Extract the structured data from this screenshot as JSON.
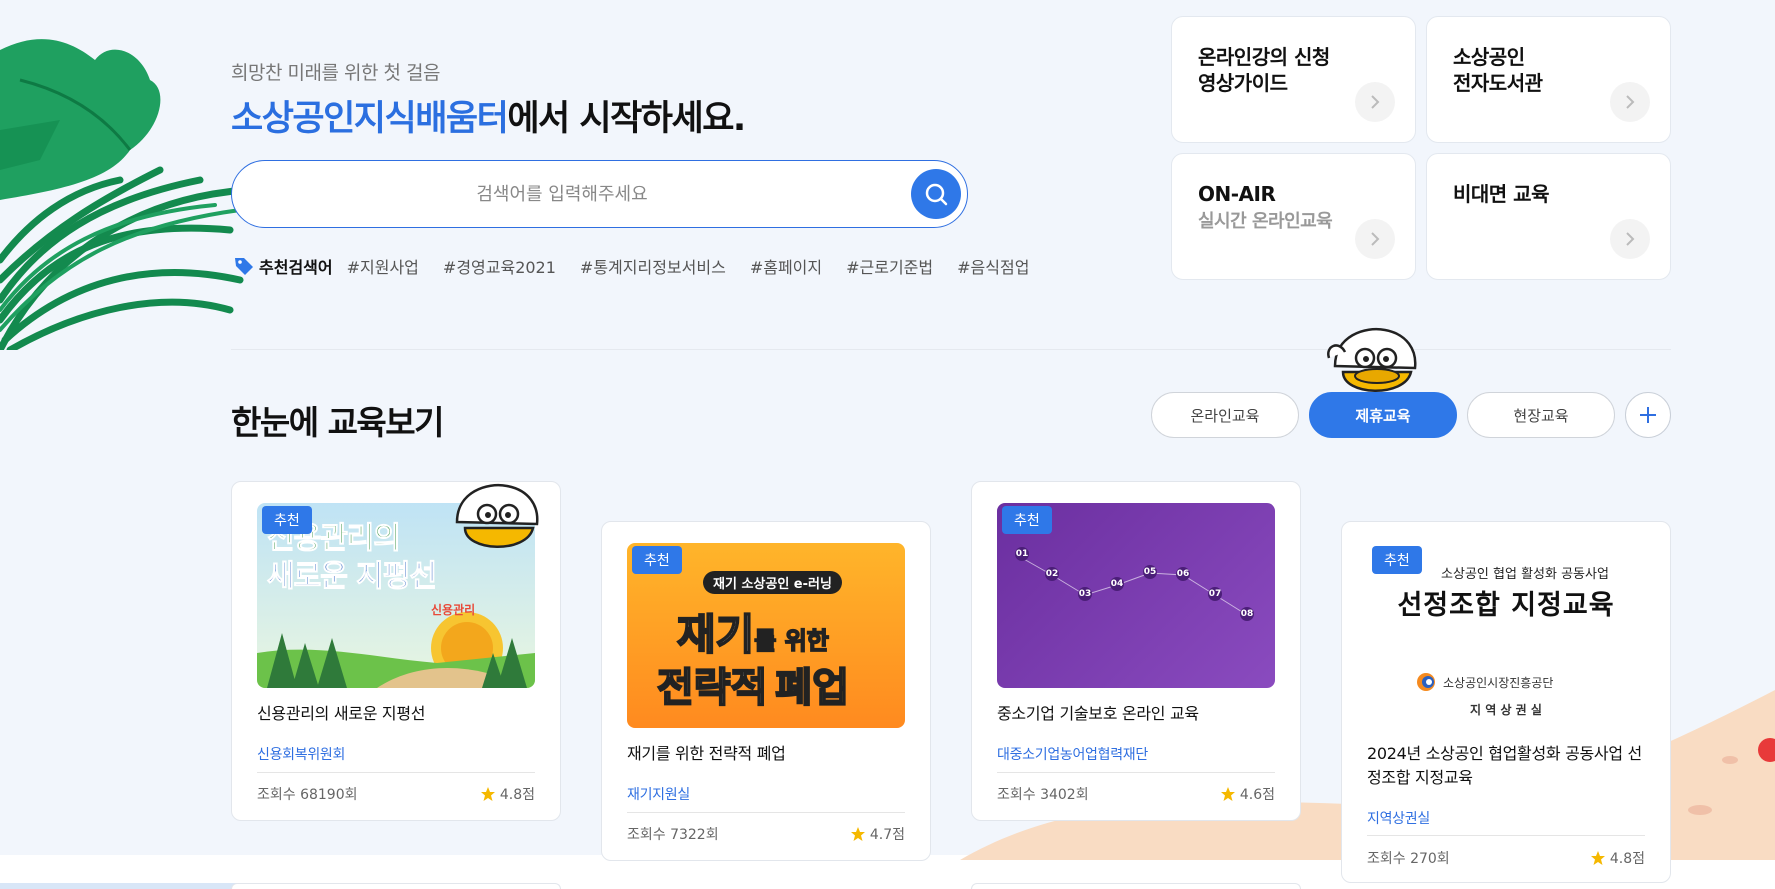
{
  "hero": {
    "subtitle": "희망찬 미래를 위한 첫 걸음",
    "title_accent": "소상공인지식배움터",
    "title_rest": "에서 시작하세요."
  },
  "search": {
    "placeholder": "검색어를 입력해주세요",
    "icon": "search-icon"
  },
  "recommended": {
    "label": "추천검색어",
    "keywords": [
      "#지원사업",
      "#경영교육2021",
      "#통계지리정보서비스",
      "#홈페이지",
      "#근로기준법",
      "#음식점업"
    ]
  },
  "quick_links": [
    {
      "title": "온라인강의 신청\n영상가이드",
      "subtitle": ""
    },
    {
      "title": "소상공인\n전자도서관",
      "subtitle": ""
    },
    {
      "title": "ON-AIR",
      "subtitle": "실시간 온라인교육"
    },
    {
      "title": "비대면 교육",
      "subtitle": ""
    }
  ],
  "section": {
    "title": "한눈에 교육보기",
    "tabs": [
      "온라인교육",
      "제휴교육",
      "현장교육"
    ],
    "active_tab": "제휴교육"
  },
  "cards": [
    {
      "badge": "추천",
      "thumb_lines": [
        "신용관리의",
        "새로운 지평선"
      ],
      "thumb_sticker": "신용관리",
      "title": "신용관리의 새로운 지평선",
      "org": "신용회복위원회",
      "views": "조회수 68190회",
      "rating": "4.8점"
    },
    {
      "badge": "추천",
      "thumb_top": "재기 소상공인 e-러닝",
      "thumb_line1_big": "재기",
      "thumb_line1_small": "를 위한",
      "thumb_line2_a": "전략적",
      "thumb_line2_b": "폐업",
      "title": "재기를 위한 전략적 폐업",
      "org": "재기지원실",
      "views": "조회수 7322회",
      "rating": "4.7점"
    },
    {
      "badge": "추천",
      "thumb_steps": [
        "01",
        "02",
        "03",
        "04",
        "05",
        "06",
        "07",
        "08"
      ],
      "title": "중소기업 기술보호 온라인 교육",
      "org": "대중소기업농어업협력재단",
      "views": "조회수 3402회",
      "rating": "4.6점"
    },
    {
      "badge": "추천",
      "thumb_top": "소상공인 협업 활성화 공동사업",
      "thumb_main": "선정조합 지정교육",
      "thumb_org": "소상공인시장진흥공단",
      "thumb_dept": "지 역 상 권 실",
      "title": "2024년 소상공인 협업활성화 공동사업 선정조합 지정교육",
      "org": "지역상권실",
      "views": "조회수 270회",
      "rating": "4.8점"
    }
  ],
  "colors": {
    "accent": "#2f78e8",
    "title_accent": "#2b6fe0",
    "star": "#f5b800",
    "leaf": "#1f9a5a"
  }
}
